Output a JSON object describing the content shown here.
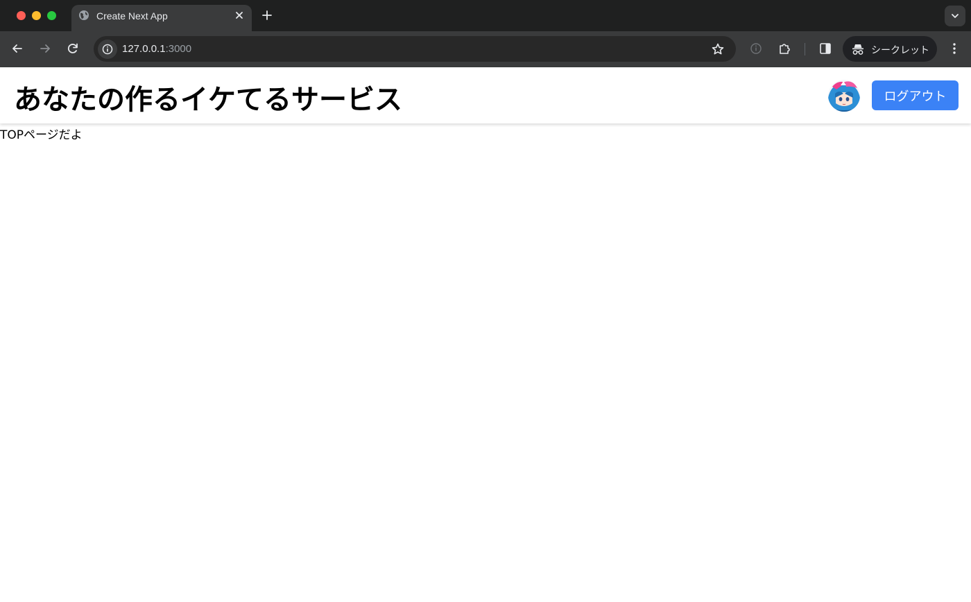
{
  "browser": {
    "tab": {
      "title": "Create Next App"
    },
    "address_bar": {
      "host": "127.0.0.1",
      "port": ":3000"
    },
    "incognito_label": "シークレット",
    "colors": {
      "frame": "#1f2020",
      "toolbar": "#3a3b3c"
    }
  },
  "header": {
    "title": "あなたの作るイケてるサービス",
    "logout_label": "ログアウト",
    "colors": {
      "button": "#3b82f6"
    }
  },
  "main": {
    "text": "TOPページだよ"
  }
}
